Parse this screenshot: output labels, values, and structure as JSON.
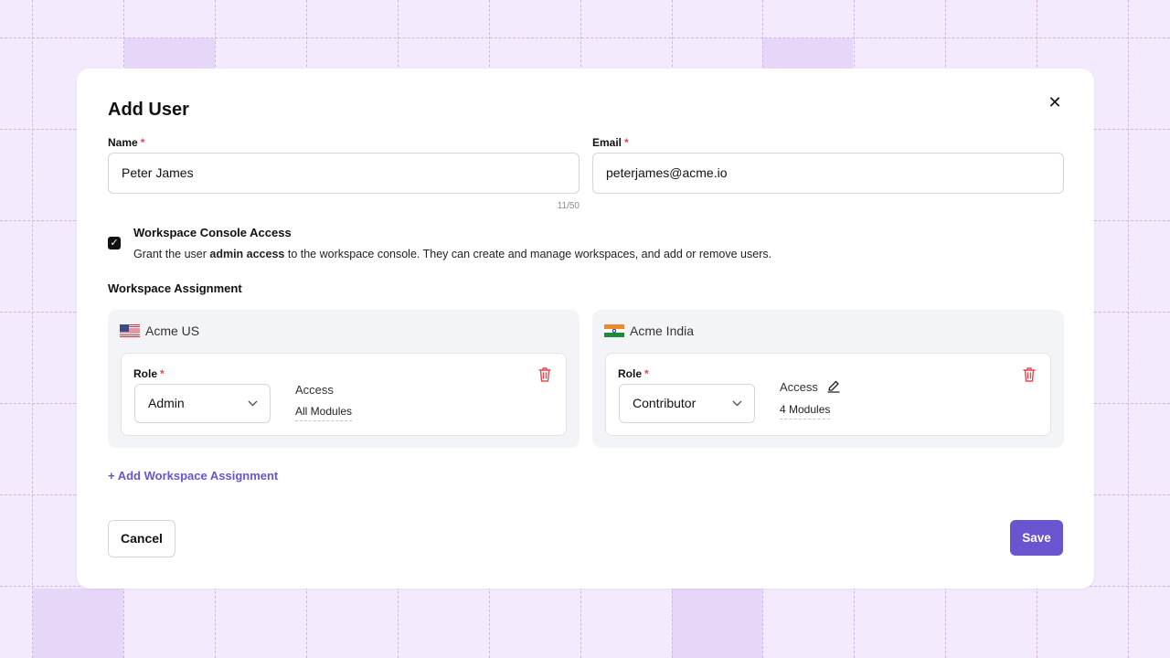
{
  "modal": {
    "title": "Add User",
    "close_icon": "close-icon"
  },
  "form": {
    "name_label": "Name",
    "name_value": "Peter James",
    "name_counter": "11/50",
    "email_label": "Email",
    "email_value": "peterjames@acme.io",
    "required_mark": "*"
  },
  "console_access": {
    "checked": true,
    "title": "Workspace Console Access",
    "desc_prefix": "Grant the user ",
    "desc_bold": "admin access",
    "desc_suffix": " to the workspace console. They can create and manage workspaces, and add or remove users."
  },
  "assignment": {
    "section_title": "Workspace Assignment",
    "workspaces": [
      {
        "name": "Acme US",
        "flag": "us-flag-icon",
        "role_label": "Role",
        "role_value": "Admin",
        "access_label": "Access",
        "access_value": "All Modules",
        "editable_access": false
      },
      {
        "name": "Acme India",
        "flag": "india-flag-icon",
        "role_label": "Role",
        "role_value": "Contributor",
        "access_label": "Access",
        "access_value": "4 Modules",
        "editable_access": true
      }
    ],
    "add_label": "+ Add Workspace Assignment"
  },
  "actions": {
    "cancel_label": "Cancel",
    "save_label": "Save"
  },
  "colors": {
    "accent": "#6b54d0",
    "danger": "#e5484d",
    "background": "#f3eafd"
  }
}
